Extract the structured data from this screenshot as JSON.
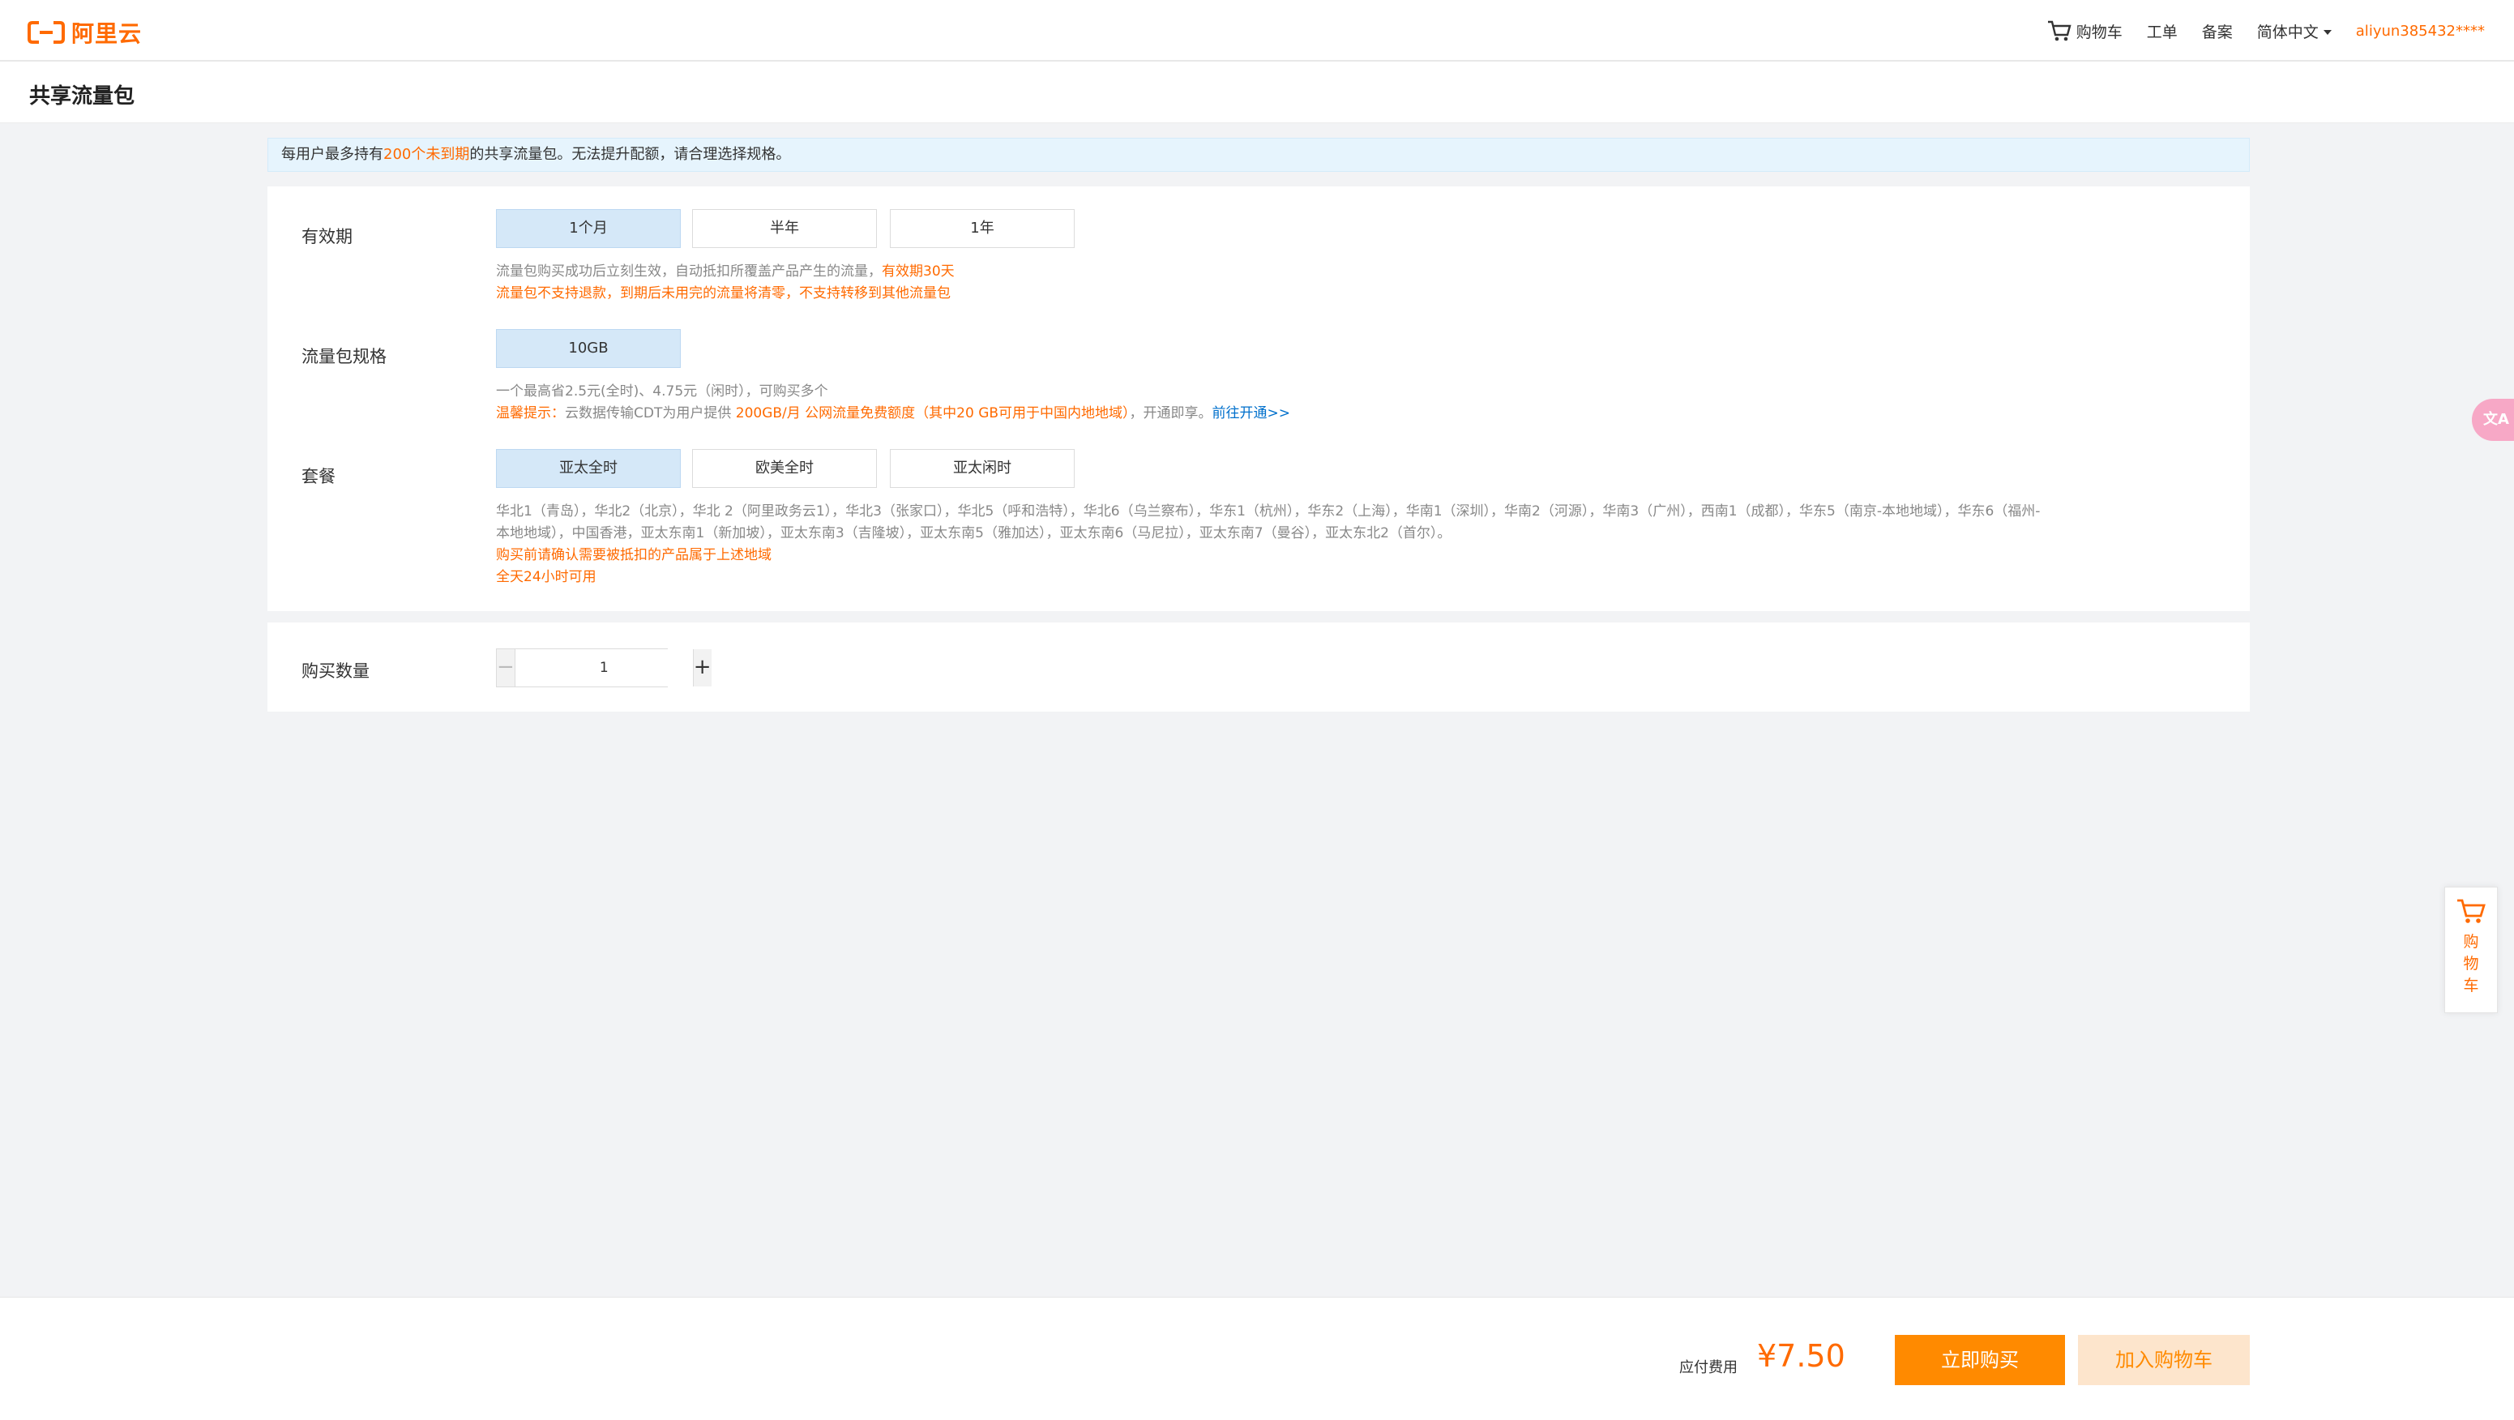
{
  "colors": {
    "brand": "#ff6a00",
    "selected_bg": "#d5e8f8",
    "notice_bg": "#e6f4fd",
    "link": "#0070cc"
  },
  "header": {
    "logo_text": "阿里云",
    "logo_icon": "aliyun-logo-icon",
    "nav": {
      "cart": "购物车",
      "ticket": "工单",
      "filing": "备案",
      "language": "简体中文",
      "user": "aliyun385432****"
    }
  },
  "page": {
    "title": "共享流量包"
  },
  "notice": {
    "prefix": "每用户最多持有",
    "highlight": "200个未到期",
    "suffix": "的共享流量包。无法提升配额，请合理选择规格。"
  },
  "validity": {
    "label": "有效期",
    "options": [
      "1个月",
      "半年",
      "1年"
    ],
    "selected": "1个月",
    "desc1_gray": "流量包购买成功后立刻生效，自动抵扣所覆盖产品产生的流量，",
    "desc1_orange": "有效期30天",
    "desc2_orange": "流量包不支持退款，到期后未用完的流量将清零，不支持转移到其他流量包"
  },
  "spec": {
    "label": "流量包规格",
    "options": [
      "10GB"
    ],
    "selected": "10GB",
    "desc1": "一个最高省2.5元(全时)、4.75元（闲时），可购买多个",
    "tip_label": "温馨提示：",
    "tip_text": "云数据传输CDT为用户提供 ",
    "tip_highlight": "200GB/月 公网流量免费额度（其中20 GB可用于中国内地地域）",
    "tip_after": "，开通即享。",
    "tip_link": "前往开通>>"
  },
  "package": {
    "label": "套餐",
    "options": [
      "亚太全时",
      "欧美全时",
      "亚太闲时"
    ],
    "selected": "亚太全时",
    "regions_line1": "华北1（青岛），华北2（北京），华北 2（阿里政务云1），华北3（张家口），华北5（呼和浩特），华北6（乌兰察布），华东1（杭州），华东2（上海），华南1（深圳），华南2（河源），华南3（广州），西南1（成都），华东5（南京-本地地域），华东6（福州-",
    "regions_line2": "本地地域），中国香港，亚太东南1（新加坡），亚太东南3（吉隆坡），亚太东南5（雅加达），亚太东南6（马尼拉），亚太东南7（曼谷），亚太东北2（首尔）。",
    "warn1": "购买前请确认需要被抵扣的产品属于上述地域",
    "warn2": "全天24小时可用"
  },
  "quantity": {
    "label": "购买数量",
    "value": "1",
    "minus": "−",
    "plus": "+"
  },
  "footer": {
    "fee_label": "应付费用",
    "fee_value": "¥7.50",
    "buy_now": "立即购买",
    "add_to_cart": "加入购物车"
  },
  "float": {
    "translate": "文A",
    "cart_label": "购物车"
  }
}
